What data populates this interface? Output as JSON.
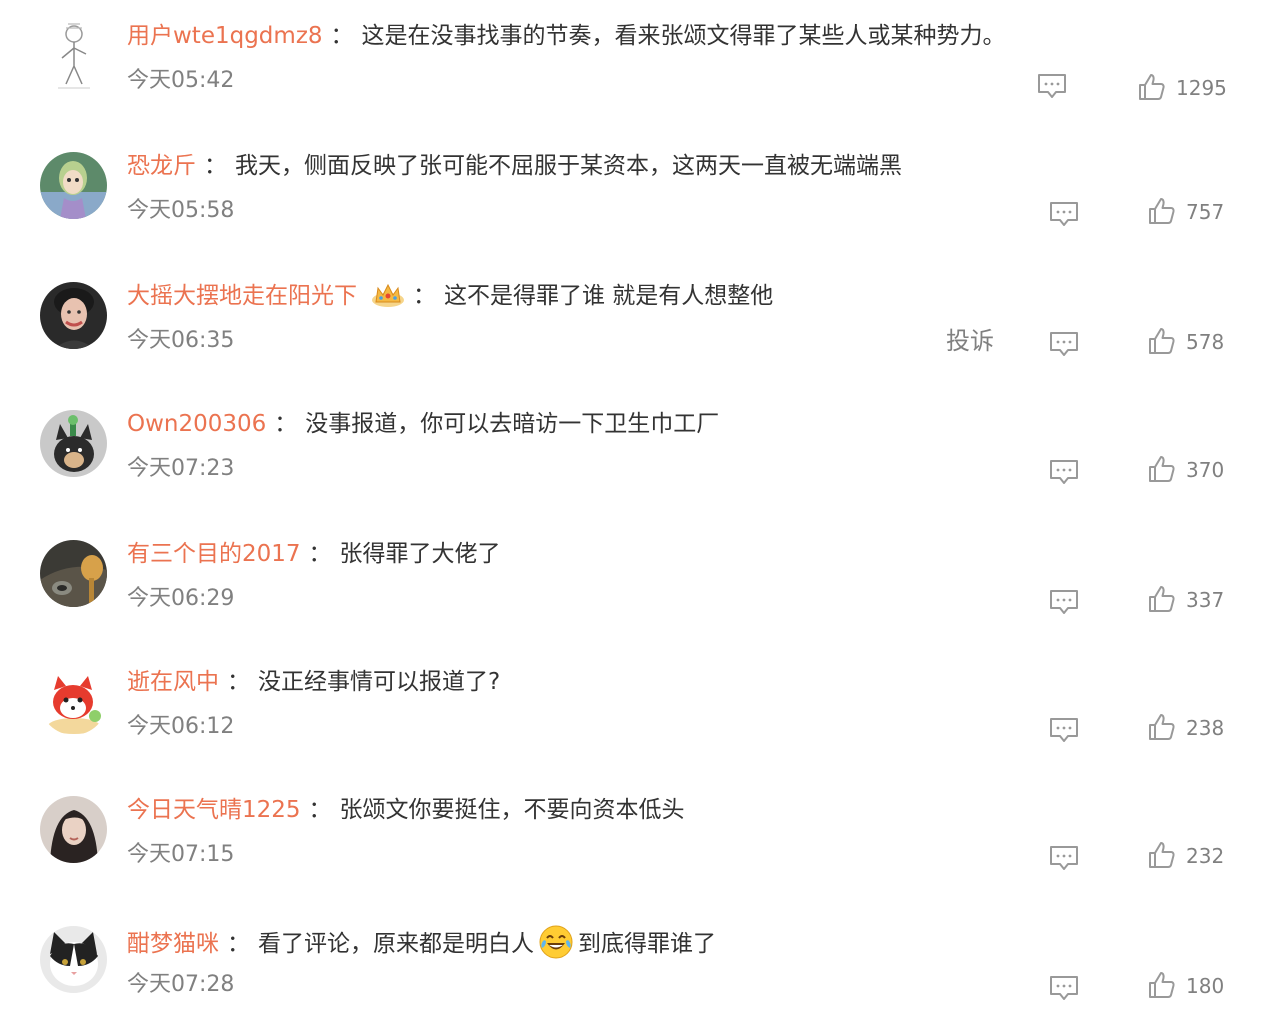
{
  "comments": [
    {
      "username": "用户wte1qgdmz8",
      "separator": "：",
      "text": "这是在没事找事的节奏，看来张颂文得罪了某些人或某种势力。",
      "time": "今天05:42",
      "likes": "1295",
      "avatar_icon": "sketch-figure-avatar"
    },
    {
      "username": "恐龙斤",
      "separator": "：",
      "text": "我天，侧面反映了张可能不屈服于某资本，这两天一直被无端端黑",
      "time": "今天05:58",
      "likes": "757",
      "avatar_icon": "doll-avatar"
    },
    {
      "username": "大摇大摆地走在阳光下",
      "separator": "：",
      "text": "这不是得罪了谁 就是有人想整他",
      "time": "今天06:35",
      "likes": "578",
      "report": "投诉",
      "avatar_icon": "woman-portrait-avatar",
      "badge_icon": "crown-badge-icon"
    },
    {
      "username": "Own200306",
      "separator": "：",
      "text": "没事报道，你可以去暗访一下卫生巾工厂",
      "time": "今天07:23",
      "likes": "370",
      "avatar_icon": "dog-avatar"
    },
    {
      "username": "有三个目的2017",
      "separator": "：",
      "text": "张得罪了大佬了",
      "time": "今天06:29",
      "likes": "337",
      "avatar_icon": "spoon-avatar"
    },
    {
      "username": "逝在风中",
      "separator": "：",
      "text": "没正经事情可以报道了?",
      "time": "今天06:12",
      "likes": "238",
      "avatar_icon": "red-fox-avatar"
    },
    {
      "username": "今日天气晴1225",
      "separator": "：",
      "text": "张颂文你要挺住，不要向资本低头",
      "time": "今天07:15",
      "likes": "232",
      "avatar_icon": "girl-portrait-avatar"
    },
    {
      "username": "酣梦猫咪",
      "separator": "：",
      "text_before": "看了评论，原来都是明白人",
      "text_after": "到底得罪谁了",
      "emoji_icon": "laughing-tears-emoji-icon",
      "time": "今天07:28",
      "likes": "180",
      "avatar_icon": "cat-avatar"
    }
  ],
  "colors": {
    "username": "#eb7350",
    "text": "#333333",
    "meta": "#808080"
  }
}
